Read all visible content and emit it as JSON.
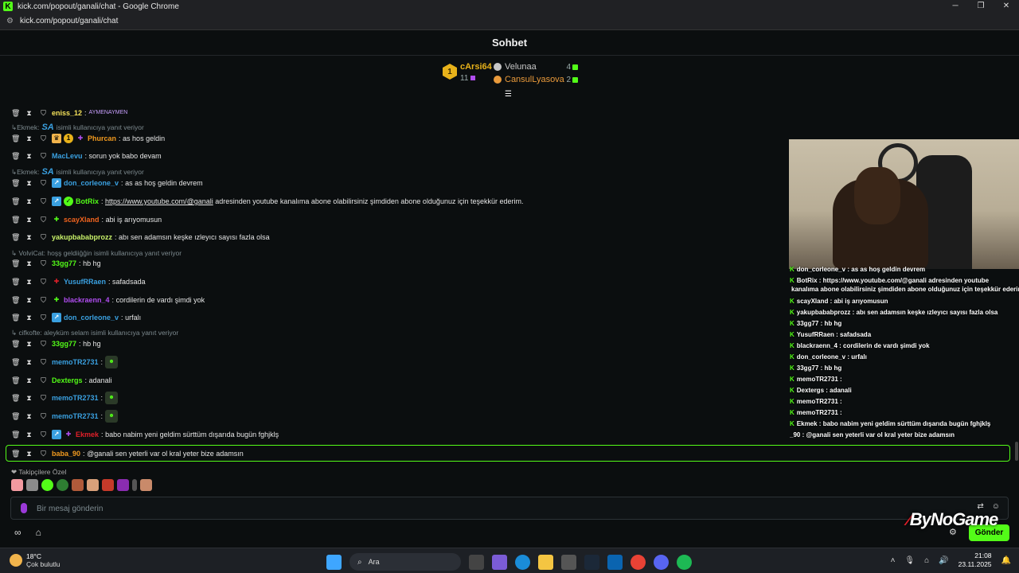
{
  "window": {
    "title": "kick.com/popout/ganali/chat - Google Chrome",
    "url": "kick.com/popout/ganali/chat"
  },
  "chat": {
    "title": "Sohbet"
  },
  "leaderboard": {
    "first": {
      "rank": "1",
      "name": "cArsi64",
      "count": "11"
    },
    "others": [
      {
        "name": "Velunaa",
        "count": "4",
        "color": "#c7c7c7"
      },
      {
        "name": "CansulLyasova",
        "count": "2",
        "color": "#e99a3b"
      }
    ]
  },
  "messages": [
    {
      "user": "eniss_12",
      "color": "#f5e25a",
      "text": "",
      "emote": "AYMENAYMEN"
    },
    {
      "reply": "Ekmek:",
      "reply_rest": "isimli kullanıcıya yanıt veriyor"
    },
    {
      "user": "Phurcan",
      "color": "#f19a1f",
      "text": "as hos geldin"
    },
    {
      "user": "MacLevu",
      "color": "#3aa0e0",
      "text": "sorun yok babo devam"
    },
    {
      "reply": "Ekmek:",
      "reply_rest": "isimli kullanıcıya yanıt veriyor"
    },
    {
      "user": "don_corleone_v",
      "color": "#3aa0e0",
      "text": "as as hoş geldin devrem"
    },
    {
      "user": "BotRix",
      "color": "#53fc18",
      "link": "https://www.youtube.com/@ganali",
      "text": "adresinden youtube kanalıma abone olabilirsiniz şimdiden abone olduğunuz için teşekkür ederim."
    },
    {
      "user": "scayXland",
      "color": "#f1641f",
      "text": "abi iş arıyomusun"
    },
    {
      "user": "yakupbababprozz",
      "color": "#c9f26a",
      "text": "abı sen adamsın keşke ızleyıcı sayısı fazla olsa"
    },
    {
      "reply": "VolviCat: hoşş geldiiğğin isimli kullanıcıya yanıt veriyor"
    },
    {
      "user": "33gg77",
      "color": "#53fc18",
      "text": "hb hg"
    },
    {
      "user": "YusufRRaen",
      "color": "#3aa0e0",
      "text": "safadsada"
    },
    {
      "user": "blackraenn_4",
      "color": "#b04df0",
      "text": "cordilerin de vardı şimdi yok"
    },
    {
      "user": "don_corleone_v",
      "color": "#3aa0e0",
      "text": "urfalı"
    },
    {
      "reply": "cifkofte: aleyküm selam isimli kullanıcıya yanıt veriyor"
    },
    {
      "user": "33gg77",
      "color": "#53fc18",
      "text": "hb hg"
    },
    {
      "user": "memoTR2731",
      "color": "#3aa0e0",
      "text": ""
    },
    {
      "user": "Dextergs",
      "color": "#53fc18",
      "text": "adanali"
    },
    {
      "user": "memoTR2731",
      "color": "#3aa0e0",
      "text": ""
    },
    {
      "user": "memoTR2731",
      "color": "#3aa0e0",
      "text": ""
    },
    {
      "user": "Ekmek",
      "color": "#e0202a",
      "text": "babo nabim yeni geldim sürttüm dışarıda bugün fghjklş"
    },
    {
      "user": "baba_90",
      "color": "#f19a1f",
      "text": "@ganali sen yeterli var ol kral yeter bize adamsın"
    }
  ],
  "followers_emotes": {
    "title": "Takipçilere Özel"
  },
  "input": {
    "placeholder": "Bir mesaj gönderin",
    "send_label": "Gönder"
  },
  "overlay": {
    "watermark_a": "By",
    "watermark_b": "NoGame",
    "lines": [
      "don_corleone_v : as as hoş geldin devrem",
      "BotRix : https://www.youtube.com/@ganali adresinden youtube",
      "kanalıma abone olabilirsiniz şimdiden abone olduğunuz için teşekkür ederim.",
      "scayXland : abi iş arıyomusun",
      "yakupbababprozz : abı sen adamsın keşke ızleyıcı sayısı fazla olsa",
      "33gg77 : hb hg",
      "YusufRRaen : safadsada",
      "blackraenn_4 : cordilerin de vardı şimdi yok",
      "don_corleone_v : urfalı",
      "33gg77 : hb hg",
      "memoTR2731 :",
      "Dextergs : adanali",
      "memoTR2731 :",
      "memoTR2731 :",
      "Ekmek : babo nabim yeni geldim sürttüm dışarıda bugün fghjklş",
      "_90 : @ganali sen yeterli var ol kral yeter bize adamsın"
    ]
  },
  "taskbar": {
    "temp": "18°C",
    "weather": "Çok bulutlu",
    "search": "Ara",
    "time": "21:08",
    "date": "23.11.2025"
  },
  "colors": {
    "accent": "#53fc18",
    "background": "#0b0e0f"
  }
}
